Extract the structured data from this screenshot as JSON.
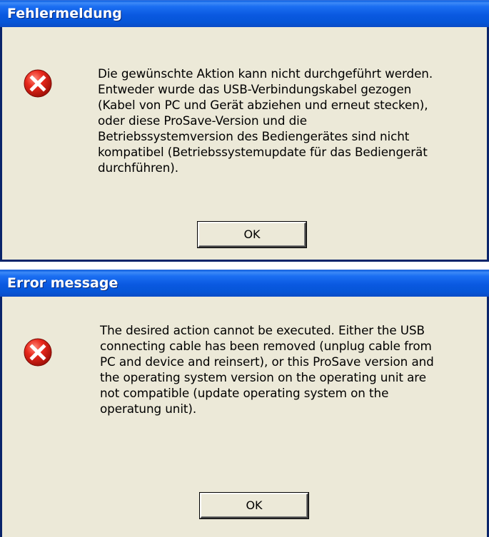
{
  "dialogs": [
    {
      "title": "Fehlermeldung",
      "icon": "error-icon",
      "message": "Die gewünschte Aktion kann nicht durchgeführt werden.\nEntweder wurde das USB-Verbindungskabel gezogen\n(Kabel von PC und Gerät abziehen und erneut stecken),\noder diese ProSave-Version und die\nBetriebssystemversion des Bediengerätes sind nicht\nkompatibel (Betriebssystemupdate für das Bediengerät\ndurchführen).",
      "ok_label": "OK"
    },
    {
      "title": "Error message",
      "icon": "error-icon",
      "message": "The desired action cannot be executed. Either the USB\nconnecting cable has been removed (unplug cable from\nPC and device and reinsert), or this ProSave version and\nthe operating system version on the operating unit are\nnot compatible (update operating system on the\noperatung unit).",
      "ok_label": "OK"
    }
  ],
  "colors": {
    "titlebar": "#0a58e0",
    "dialog_background": "#ece9d8",
    "frame": "#0a246a",
    "error_icon": "#e0201a"
  }
}
